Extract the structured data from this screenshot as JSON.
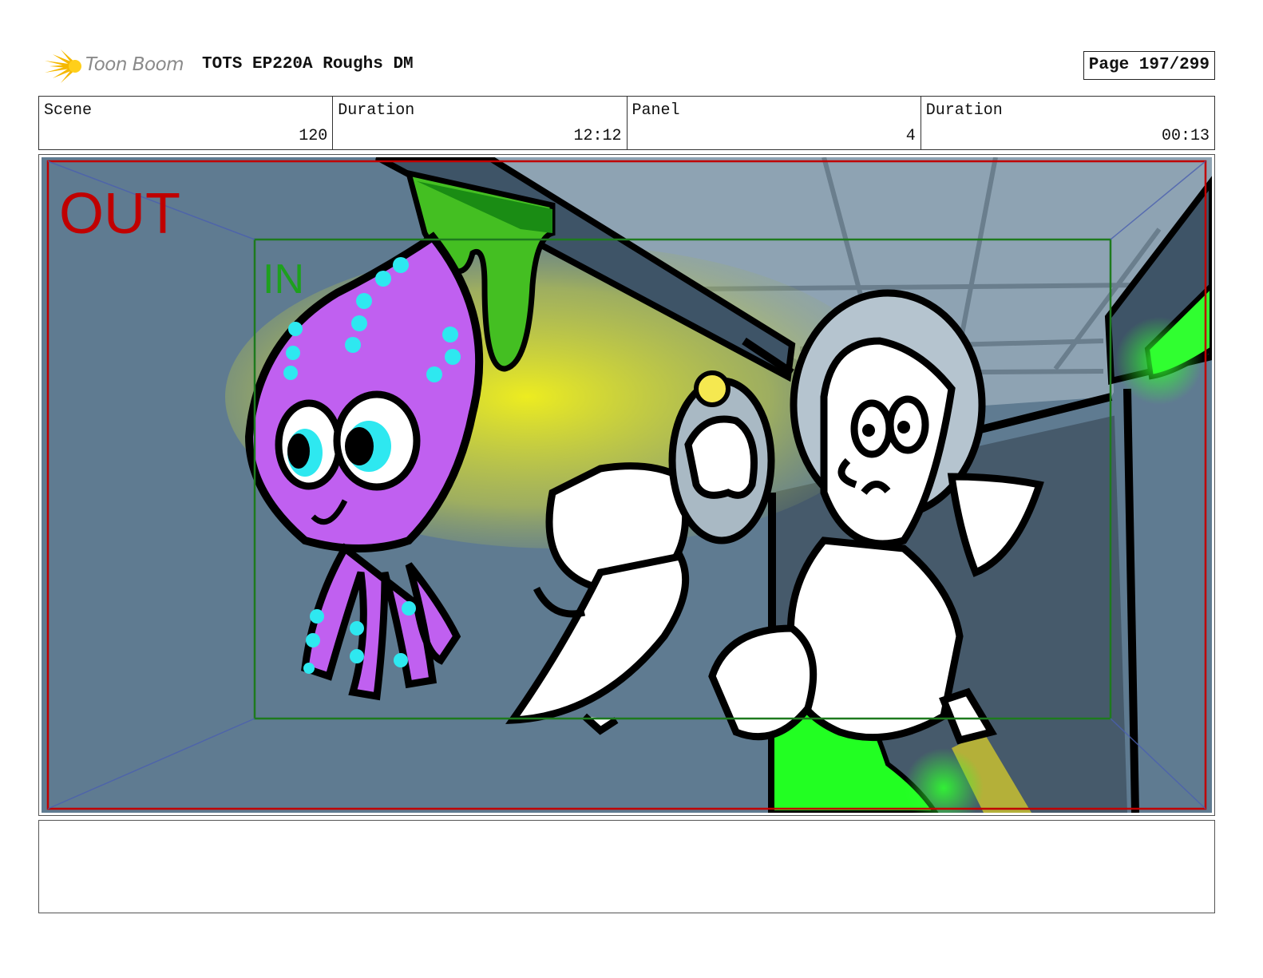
{
  "header": {
    "logo_text": "Toon Boom",
    "doc_title": "TOTS EP220A Roughs DM",
    "page": "Page 197/299"
  },
  "info": [
    {
      "label": "Scene",
      "value": "120"
    },
    {
      "label": "Duration",
      "value": "12:12"
    },
    {
      "label": "Panel",
      "value": "4"
    },
    {
      "label": "Duration",
      "value": "00:13"
    }
  ],
  "panel": {
    "out_label": "OUT",
    "in_label": "IN"
  },
  "notes": {
    "text": ""
  },
  "colors": {
    "out_frame": "#c00000",
    "in_frame": "#1e7a1e",
    "background": "#5f7a90",
    "squid": "#c060f0",
    "spots": "#22e6f0",
    "slime": "#22ff22",
    "light_beam": "#f0f020"
  }
}
